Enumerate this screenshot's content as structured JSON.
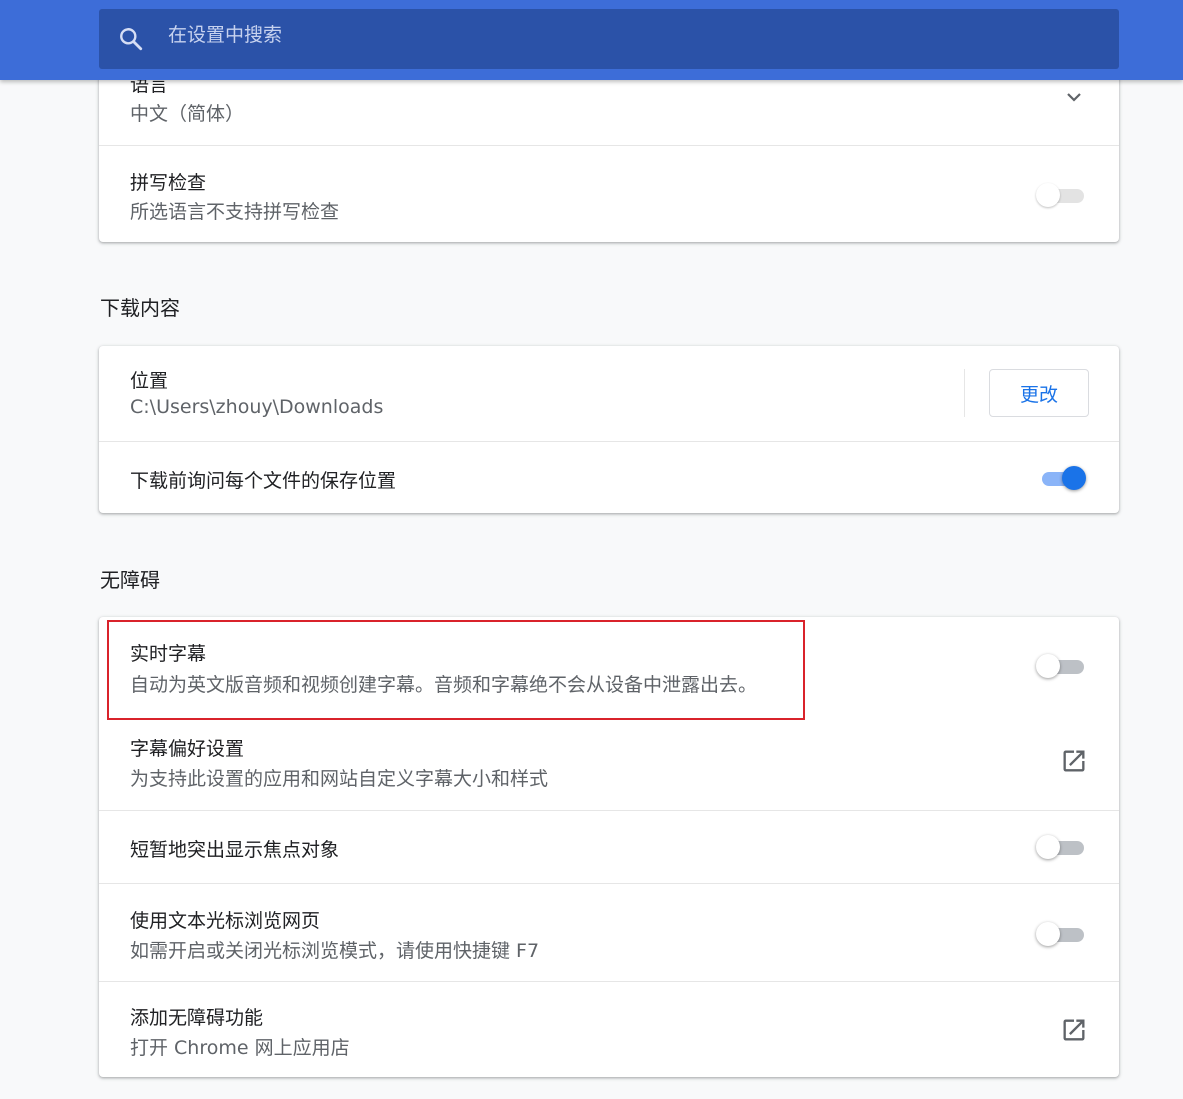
{
  "search": {
    "placeholder": "在设置中搜索"
  },
  "language_card": {
    "language_title": "语言",
    "language_value": "中文（简体）",
    "spellcheck_title": "拼写检查",
    "spellcheck_sub": "所选语言不支持拼写检查",
    "spellcheck_enabled": false
  },
  "downloads": {
    "heading": "下载内容",
    "location_title": "位置",
    "location_path": "C:\\Users\\zhouy\\Downloads",
    "change_button": "更改",
    "ask_title": "下载前询问每个文件的保存位置",
    "ask_enabled": true
  },
  "accessibility": {
    "heading": "无障碍",
    "live_caption_title": "实时字幕",
    "live_caption_sub": "自动为英文版音频和视频创建字幕。音频和字幕绝不会从设备中泄露出去。",
    "live_caption_enabled": false,
    "caption_pref_title": "字幕偏好设置",
    "caption_pref_sub": "为支持此设置的应用和网站自定义字幕大小和样式",
    "focus_highlight_title": "短暂地突出显示焦点对象",
    "focus_highlight_enabled": false,
    "caret_browsing_title": "使用文本光标浏览网页",
    "caret_browsing_sub": "如需开启或关闭光标浏览模式，请使用快捷键 F7",
    "caret_browsing_enabled": false,
    "add_features_title": "添加无障碍功能",
    "add_features_sub": "打开 Chrome 网上应用店"
  },
  "colors": {
    "header": "#3d6dd8",
    "accent": "#1a73e8",
    "highlight_box": "#d9232b"
  }
}
